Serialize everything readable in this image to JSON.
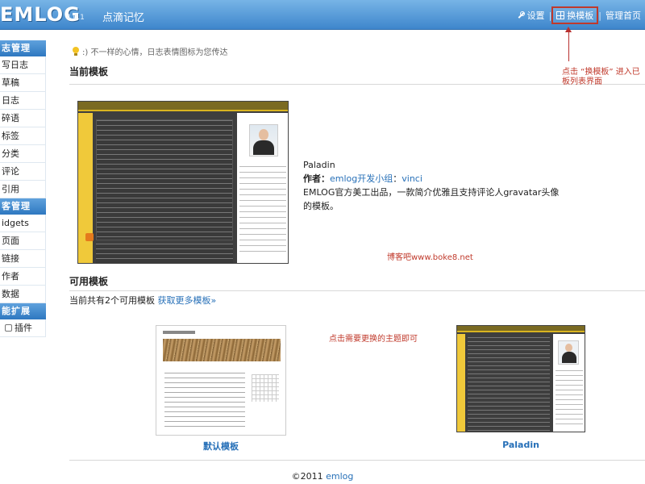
{
  "header": {
    "logo": "EMLOG",
    "version": "4.0.1",
    "app_name": "点滴记忆",
    "settings_label": "设置",
    "change_template_label": "换模板",
    "admin_home_label": "管理首页",
    "separator": "|"
  },
  "sidebar": {
    "sections": [
      {
        "heading": "志管理",
        "items": [
          "写日志",
          "草稿",
          "日志",
          "碎语",
          "标签",
          "分类",
          "评论",
          "引用"
        ]
      },
      {
        "heading": "客管理",
        "items": [
          "idgets",
          "页面",
          "链接",
          "作者",
          "数据"
        ]
      },
      {
        "heading": "能扩展",
        "items": [
          "插件"
        ]
      }
    ]
  },
  "tip": {
    "text": ":) 不一样的心情，日志表情图标为您传达"
  },
  "current_template": {
    "heading": "当前模板",
    "name": "Paladin",
    "author_prefix": "作者：",
    "author_link": "emlog开发小组",
    "author_sep": "：",
    "author_name": "vinci",
    "desc": "EMLOG官方美工出品，一款简介优雅且支持评论人gravatar头像的模板。"
  },
  "annotations": {
    "arrow_note_line1": "点击 “换模板” 进入已",
    "arrow_note_line2": "板列表界面",
    "watermark": "博客吧www.boke8.net",
    "click_note": "点击需要更换的主题即可"
  },
  "available_templates": {
    "heading": "可用模板",
    "count_text": "当前共有2个可用模板",
    "more_link": "获取更多模板»",
    "items": [
      {
        "label": "默认模板"
      },
      {
        "label": "Paladin"
      }
    ]
  },
  "footer": {
    "copyright": "©2011",
    "link": "emlog"
  }
}
